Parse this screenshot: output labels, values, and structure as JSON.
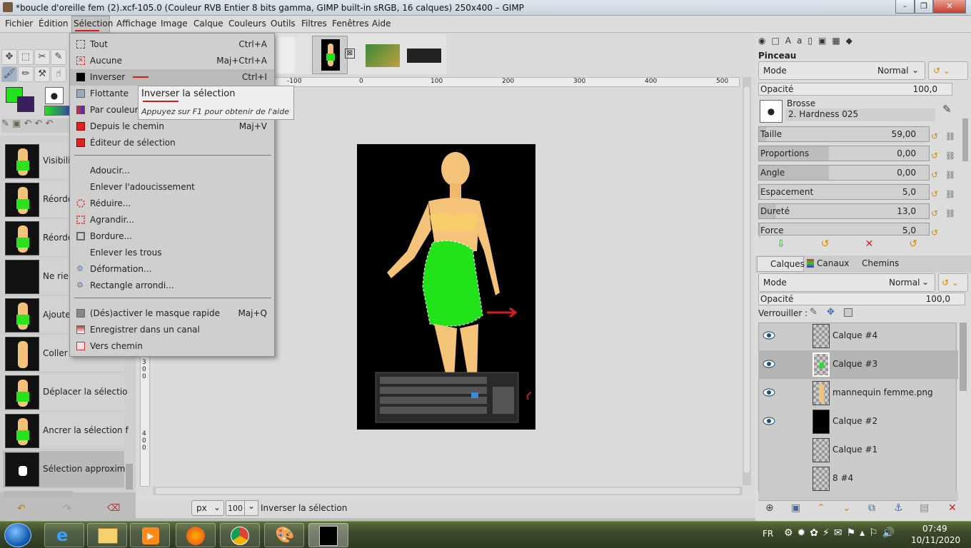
{
  "window": {
    "title": "*boucle d'oreille fem (2).xcf-105.0 (Couleur RVB Entier 8 bits gamma, GIMP built-in sRGB, 16 calques) 250x400 – GIMP",
    "minimize": "–",
    "maximize": "❐",
    "close": "✕"
  },
  "menubar": [
    "Fichier",
    "Édition",
    "Sélection",
    "Affichage",
    "Image",
    "Calque",
    "Couleurs",
    "Outils",
    "Filtres",
    "Fenêtres",
    "Aide"
  ],
  "selection_menu": {
    "items": [
      {
        "label": "Tout",
        "shortcut": "Ctrl+A"
      },
      {
        "label": "Aucune",
        "shortcut": "Maj+Ctrl+A"
      },
      {
        "label": "Inverser",
        "shortcut": "Ctrl+I"
      },
      {
        "label": "Flottante",
        "shortcut": ""
      },
      {
        "label": "Par couleur",
        "shortcut": ""
      },
      {
        "label": "Depuis le chemin",
        "shortcut": "Maj+V"
      },
      {
        "label": "Éditeur de sélection",
        "shortcut": ""
      },
      {
        "label": "Adoucir...",
        "shortcut": ""
      },
      {
        "label": "Enlever l'adoucissement",
        "shortcut": ""
      },
      {
        "label": "Réduire...",
        "shortcut": ""
      },
      {
        "label": "Agrandir...",
        "shortcut": ""
      },
      {
        "label": "Bordure...",
        "shortcut": ""
      },
      {
        "label": "Enlever les trous",
        "shortcut": ""
      },
      {
        "label": "Déformation...",
        "shortcut": ""
      },
      {
        "label": "Rectangle arrondi...",
        "shortcut": ""
      },
      {
        "label": "(Dés)activer le masque rapide",
        "shortcut": "Maj+Q"
      },
      {
        "label": "Enregistrer dans un canal",
        "shortcut": ""
      },
      {
        "label": "Vers chemin",
        "shortcut": ""
      }
    ]
  },
  "tooltip": {
    "title": "Inverser la sélection",
    "hint": "Appuyez sur F1 pour obtenir de l'aide"
  },
  "history": [
    {
      "label": "Visibili"
    },
    {
      "label": "Réordo"
    },
    {
      "label": "Réordo"
    },
    {
      "label": "Ne rien"
    },
    {
      "label": "Ajoute"
    },
    {
      "label": "Coller"
    },
    {
      "label": "Déplacer la sélectio"
    },
    {
      "label": "Ancrer la sélection f"
    },
    {
      "label": "Sélection approxima"
    }
  ],
  "rulers": {
    "top": [
      "-100",
      "0",
      "100",
      "200",
      "300",
      "400",
      "500"
    ],
    "left_a": [
      "3",
      "0",
      "0"
    ],
    "left_b": [
      "4",
      "0",
      "0"
    ]
  },
  "tool_options": {
    "title": "Pinceau",
    "mode_label": "Mode",
    "mode_value": "Normal",
    "opacity_label": "Opacité",
    "opacity_value": "100,0",
    "brush_label": "Brosse",
    "brush_value": "2. Hardness 025",
    "sliders": [
      {
        "label": "Taille",
        "value": "59,00",
        "fill": 0.04
      },
      {
        "label": "Proportions",
        "value": "0,00",
        "fill": 0.41
      },
      {
        "label": "Angle",
        "value": "0,00",
        "fill": 0.41
      },
      {
        "label": "Espacement",
        "value": "5,0",
        "fill": 0.01
      },
      {
        "label": "Dureté",
        "value": "13,0",
        "fill": 0.1
      },
      {
        "label": "Force",
        "value": "5,0",
        "fill": 0.01
      }
    ]
  },
  "layers_panel": {
    "tabs": [
      "Calques",
      "Canaux",
      "Chemins"
    ],
    "mode_label": "Mode",
    "mode_value": "Normal",
    "opacity_label": "Opacité",
    "opacity_value": "100,0",
    "lock_label": "Verrouiller :",
    "layers": [
      {
        "name": "Calque #4",
        "visible": true
      },
      {
        "name": "Calque #3",
        "visible": true
      },
      {
        "name": "mannequin femme.png",
        "visible": true
      },
      {
        "name": "Calque #2",
        "visible": true
      },
      {
        "name": "Calque #1",
        "visible": false
      },
      {
        "name": "8 #4",
        "visible": false
      }
    ]
  },
  "statusbar": {
    "unit": "px",
    "zoom": "100 %",
    "message": "Inverser la sélection"
  },
  "taskbar": {
    "lang": "FR",
    "time": "07:49",
    "date": "10/11/2020"
  },
  "colors": {
    "fg": "#22e21a",
    "bg": "#3a1f5e",
    "accent_red": "#d21e1e"
  }
}
